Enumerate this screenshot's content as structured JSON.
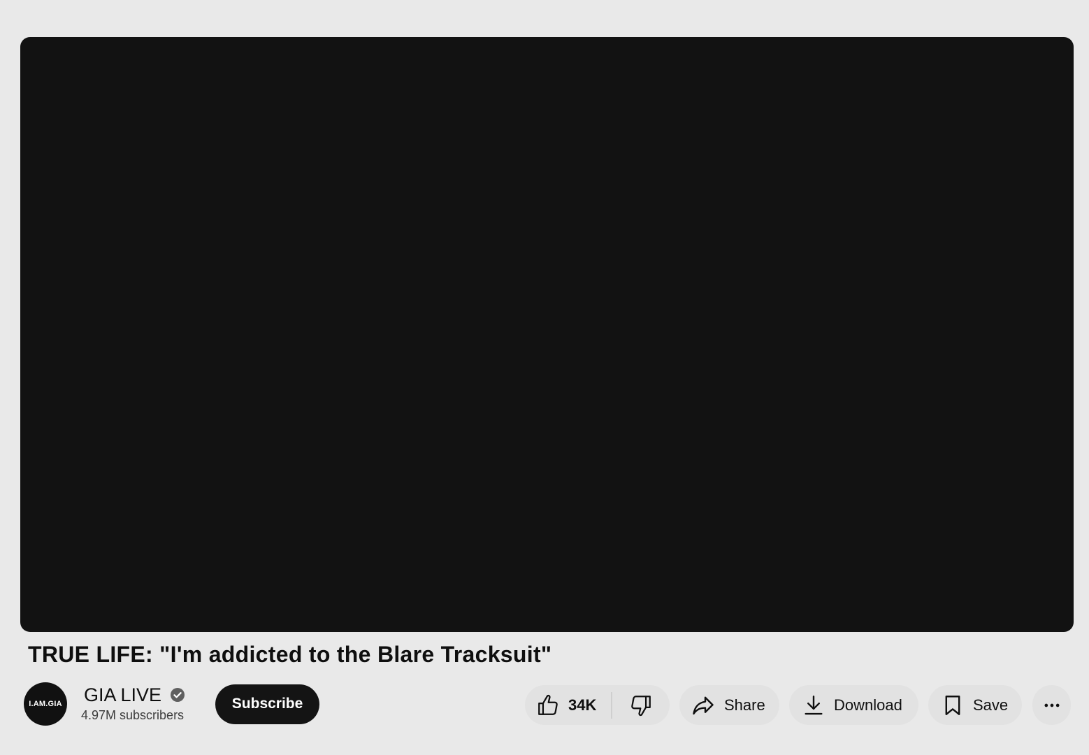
{
  "video": {
    "title": "TRUE LIFE: \"I'm addicted to the Blare Tracksuit\""
  },
  "channel": {
    "avatar_text": "I.AM.GIA",
    "name": "GIA LIVE",
    "subscribers": "4.97M subscribers",
    "verified_icon": "verified-check-icon"
  },
  "subscribe": {
    "label": "Subscribe"
  },
  "actions": {
    "like_count": "34K",
    "share_label": "Share",
    "download_label": "Download",
    "save_label": "Save"
  },
  "icons": {
    "like": "thumbs-up-icon",
    "dislike": "thumbs-down-icon",
    "share": "share-arrow-icon",
    "download": "download-icon",
    "save": "bookmark-icon",
    "more": "more-horizontal-icon"
  },
  "colors": {
    "background": "#e9e9e9",
    "player": "#121212",
    "subscribe_bg": "#141414",
    "pill_bg": "#e2e2e2"
  }
}
